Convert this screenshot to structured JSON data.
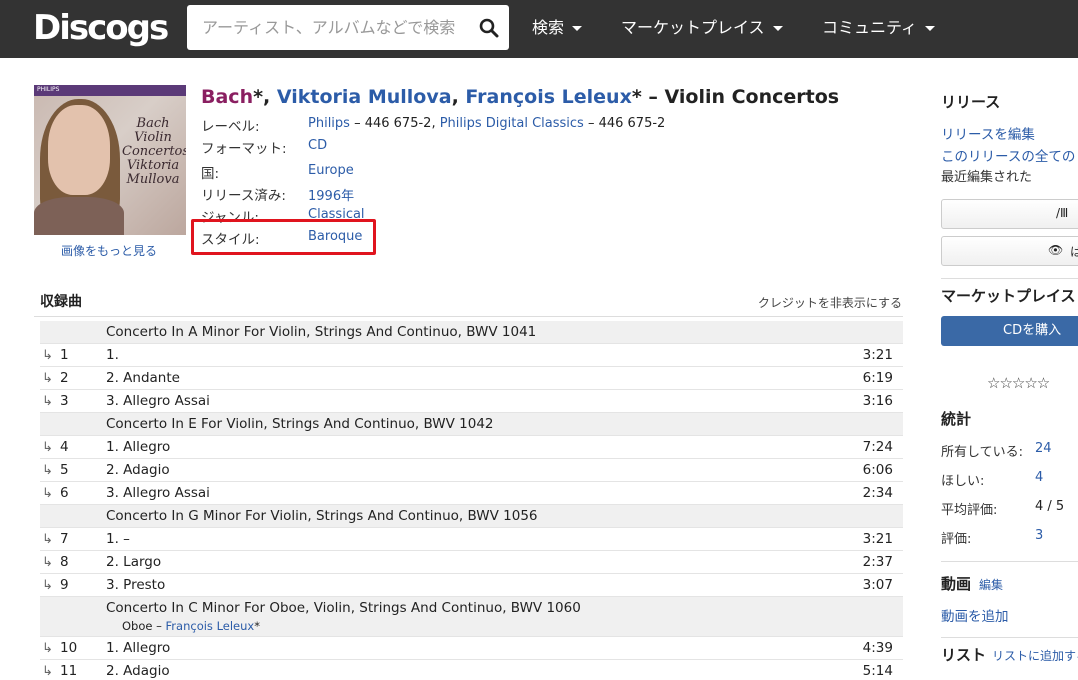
{
  "header": {
    "logo": "Discogs",
    "search_placeholder": "アーティスト、アルバムなどで検索",
    "nav": [
      "検索",
      "マーケットプレイス",
      "コミュニティ"
    ]
  },
  "release": {
    "cover_label": "PHILIPS",
    "cover_text": [
      "Bach",
      "Violin",
      "Concertos",
      "Viktoria",
      "Mullova"
    ],
    "more_images": "画像をもっと見る",
    "title": {
      "artist1": "Bach",
      "star1": "*, ",
      "artist2": "Viktoria Mullova",
      "comma": ", ",
      "artist3": "François Leleux",
      "rest": "* – Violin Concertos"
    },
    "profile": {
      "label_lbl": "レーベル:",
      "label_link1": "Philips",
      "label_cat1": " – 446 675-2, ",
      "label_link2": "Philips Digital Classics",
      "label_cat2": " – 446 675-2",
      "format_lbl": "フォーマット:",
      "format_val": "CD",
      "country_lbl": "国:",
      "country_val": "Europe",
      "released_lbl": "リリース済み:",
      "released_val": "1996年",
      "genre_lbl": "ジャンル:",
      "genre_val": "Classical",
      "style_lbl": "スタイル:",
      "style_val": "Baroque"
    }
  },
  "tracklist": {
    "title": "収録曲",
    "toggle": "クレジットを非表示にする",
    "rows": [
      {
        "type": "heading",
        "title": "Concerto In A Minor For Violin, Strings And Continuo, BWV 1041"
      },
      {
        "type": "track",
        "pos": "1",
        "title": "1.",
        "dur": "3:21"
      },
      {
        "type": "track",
        "pos": "2",
        "title": "2. Andante",
        "dur": "6:19"
      },
      {
        "type": "track",
        "pos": "3",
        "title": "3. Allegro Assai",
        "dur": "3:16"
      },
      {
        "type": "heading",
        "title": "Concerto In E For Violin, Strings And Continuo, BWV 1042"
      },
      {
        "type": "track",
        "pos": "4",
        "title": "1. Allegro",
        "dur": "7:24"
      },
      {
        "type": "track",
        "pos": "5",
        "title": "2. Adagio",
        "dur": "6:06"
      },
      {
        "type": "track",
        "pos": "6",
        "title": "3. Allegro Assai",
        "dur": "2:34"
      },
      {
        "type": "heading",
        "title": "Concerto In G Minor For Violin, Strings And Continuo, BWV 1056"
      },
      {
        "type": "track",
        "pos": "7",
        "title": "1. –",
        "dur": "3:21"
      },
      {
        "type": "track",
        "pos": "8",
        "title": "2. Largo",
        "dur": "2:37"
      },
      {
        "type": "track",
        "pos": "9",
        "title": "3. Presto",
        "dur": "3:07"
      },
      {
        "type": "heading",
        "title": "Concerto In C Minor For Oboe, Violin, Strings And Continuo, BWV 1060",
        "credit_role": "Oboe – ",
        "credit_name": "François Leleux",
        "credit_star": "*"
      },
      {
        "type": "track",
        "pos": "10",
        "title": "1. Allegro",
        "dur": "4:39"
      },
      {
        "type": "track",
        "pos": "11",
        "title": "2. Adagio",
        "dur": "5:14"
      }
    ]
  },
  "sidebar": {
    "release_title": "リリース",
    "edit_release": "リリースを編集",
    "all_versions": "このリリースの全ての",
    "last_edited": "最近編集された",
    "btn1_text": "/Ⅲ",
    "btn2_text": "は",
    "marketplace_title": "マーケットプレイス",
    "buy_cd": "CDを購入",
    "rating_stars": "☆☆☆☆☆",
    "stats_title": "統計",
    "have_lbl": "所有している:",
    "have_val": "24",
    "want_lbl": "ほしい:",
    "want_val": "4",
    "avg_lbl": "平均評価:",
    "avg_val": "4 / 5",
    "ratings_lbl": "評価:",
    "ratings_val": "3",
    "videos_title": "動画",
    "videos_edit": "編集",
    "add_video": "動画を追加",
    "lists_title": "リスト",
    "add_to_list": "リストに追加する"
  }
}
